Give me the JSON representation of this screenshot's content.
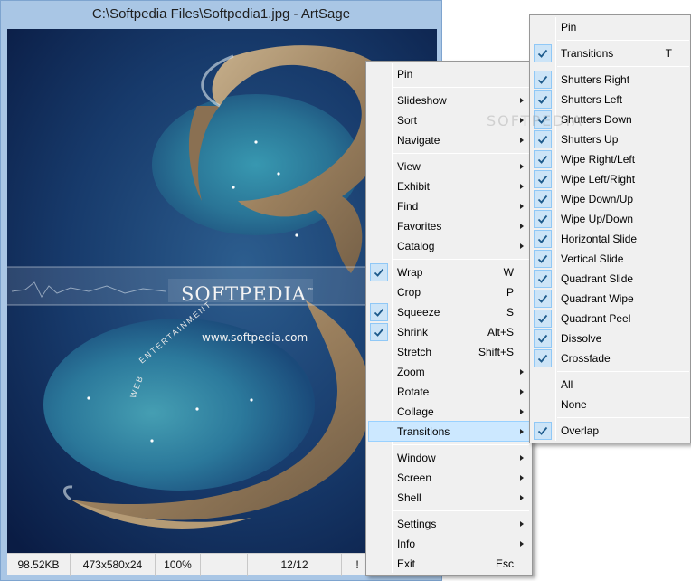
{
  "window": {
    "title": "C:\\Softpedia Files\\Softpedia1.jpg - ArtSage"
  },
  "image": {
    "logo_text": "SOFTPEDIA",
    "logo_superscript": "™",
    "url_text": "www.softpedia.com",
    "arc_text_web": "WEB",
    "arc_text_ent": "ENTERTAINMENT",
    "watermark": "SOFTPEDIA"
  },
  "status": {
    "size": "98.52KB",
    "dimensions": "473x580x24",
    "zoom": "100%",
    "position": "12/12",
    "flag": "!"
  },
  "main_menu": {
    "items": [
      {
        "label": "Pin",
        "shortcut": "",
        "submenu": false,
        "checked": false
      },
      {
        "label": "Slideshow",
        "shortcut": "",
        "submenu": true,
        "checked": false
      },
      {
        "label": "Sort",
        "shortcut": "",
        "submenu": true,
        "checked": false
      },
      {
        "label": "Navigate",
        "shortcut": "",
        "submenu": true,
        "checked": false
      },
      {
        "label": "View",
        "shortcut": "",
        "submenu": true,
        "checked": false
      },
      {
        "label": "Exhibit",
        "shortcut": "",
        "submenu": true,
        "checked": false
      },
      {
        "label": "Find",
        "shortcut": "",
        "submenu": true,
        "checked": false
      },
      {
        "label": "Favorites",
        "shortcut": "",
        "submenu": true,
        "checked": false
      },
      {
        "label": "Catalog",
        "shortcut": "",
        "submenu": true,
        "checked": false
      },
      {
        "label": "Wrap",
        "shortcut": "W",
        "submenu": false,
        "checked": true
      },
      {
        "label": "Crop",
        "shortcut": "P",
        "submenu": false,
        "checked": false
      },
      {
        "label": "Squeeze",
        "shortcut": "S",
        "submenu": false,
        "checked": true
      },
      {
        "label": "Shrink",
        "shortcut": "Alt+S",
        "submenu": false,
        "checked": true
      },
      {
        "label": "Stretch",
        "shortcut": "Shift+S",
        "submenu": false,
        "checked": false
      },
      {
        "label": "Zoom",
        "shortcut": "",
        "submenu": true,
        "checked": false
      },
      {
        "label": "Rotate",
        "shortcut": "",
        "submenu": true,
        "checked": false
      },
      {
        "label": "Collage",
        "shortcut": "",
        "submenu": true,
        "checked": false
      },
      {
        "label": "Transitions",
        "shortcut": "",
        "submenu": true,
        "checked": false,
        "highlighted": true
      },
      {
        "label": "Window",
        "shortcut": "",
        "submenu": true,
        "checked": false
      },
      {
        "label": "Screen",
        "shortcut": "",
        "submenu": true,
        "checked": false
      },
      {
        "label": "Shell",
        "shortcut": "",
        "submenu": true,
        "checked": false
      },
      {
        "label": "Settings",
        "shortcut": "",
        "submenu": true,
        "checked": false
      },
      {
        "label": "Info",
        "shortcut": "",
        "submenu": true,
        "checked": false
      },
      {
        "label": "Exit",
        "shortcut": "Esc",
        "submenu": false,
        "checked": false
      }
    ]
  },
  "transitions_menu": {
    "items": [
      {
        "label": "Pin",
        "shortcut": "",
        "checked": false
      },
      {
        "label": "Transitions",
        "shortcut": "T",
        "checked": true
      },
      {
        "label": "Shutters Right",
        "shortcut": "",
        "checked": true
      },
      {
        "label": "Shutters Left",
        "shortcut": "",
        "checked": true
      },
      {
        "label": "Shutters Down",
        "shortcut": "",
        "checked": true
      },
      {
        "label": "Shutters Up",
        "shortcut": "",
        "checked": true
      },
      {
        "label": "Wipe Right/Left",
        "shortcut": "",
        "checked": true
      },
      {
        "label": "Wipe Left/Right",
        "shortcut": "",
        "checked": true
      },
      {
        "label": "Wipe Down/Up",
        "shortcut": "",
        "checked": true
      },
      {
        "label": "Wipe Up/Down",
        "shortcut": "",
        "checked": true
      },
      {
        "label": "Horizontal Slide",
        "shortcut": "",
        "checked": true
      },
      {
        "label": "Vertical Slide",
        "shortcut": "",
        "checked": true
      },
      {
        "label": "Quadrant Slide",
        "shortcut": "",
        "checked": true
      },
      {
        "label": "Quadrant Wipe",
        "shortcut": "",
        "checked": true
      },
      {
        "label": "Quadrant Peel",
        "shortcut": "",
        "checked": true
      },
      {
        "label": "Dissolve",
        "shortcut": "",
        "checked": true
      },
      {
        "label": "Crossfade",
        "shortcut": "",
        "checked": true
      },
      {
        "label": "All",
        "shortcut": "",
        "checked": false
      },
      {
        "label": "None",
        "shortcut": "",
        "checked": false
      },
      {
        "label": "Overlap",
        "shortcut": "",
        "checked": true
      }
    ]
  },
  "colors": {
    "window_frame": "#a9c6e5",
    "menu_background": "#f0f0f0",
    "highlight": "#cce8ff",
    "check_background": "#cce4f7",
    "check_mark": "#1e5b8c"
  }
}
